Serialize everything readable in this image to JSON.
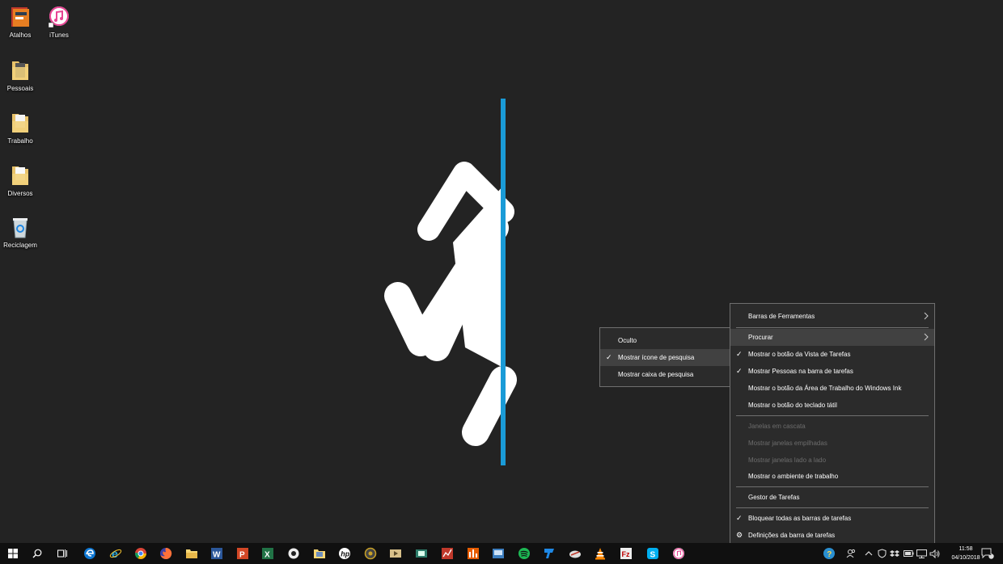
{
  "desktop": {
    "icons": [
      {
        "label": "Atalhos",
        "icon": "shortcuts-icon"
      },
      {
        "label": "iTunes",
        "icon": "itunes-icon"
      },
      {
        "label": "Pessoais",
        "icon": "folder-icon"
      },
      {
        "label": "Trabalho",
        "icon": "folder-icon"
      },
      {
        "label": "Diversos",
        "icon": "folder-icon"
      },
      {
        "label": "Reciclagem",
        "icon": "recycle-bin-icon"
      }
    ]
  },
  "submenu_search": {
    "items": [
      {
        "label": "Oculto",
        "checked": false
      },
      {
        "label": "Mostrar ícone de pesquisa",
        "checked": true
      },
      {
        "label": "Mostrar caixa de pesquisa",
        "checked": false
      }
    ]
  },
  "context_menu": {
    "items": [
      {
        "label": "Barras de Ferramentas",
        "submenu": true
      },
      {
        "label": "Procurar",
        "submenu": true
      },
      {
        "label": "Mostrar o botão da Vista de Tarefas",
        "checked": true
      },
      {
        "label": "Mostrar Pessoas na barra de tarefas",
        "checked": true
      },
      {
        "label": "Mostrar o botão da Área de Trabalho do Windows Ink"
      },
      {
        "label": "Mostrar o botão do teclado tátil"
      },
      {
        "label": "Janelas em cascata",
        "disabled": true
      },
      {
        "label": "Mostrar janelas empilhadas",
        "disabled": true
      },
      {
        "label": "Mostrar janelas lado a lado",
        "disabled": true
      },
      {
        "label": "Mostrar o ambiente de trabalho"
      },
      {
        "label": "Gestor de Tarefas"
      },
      {
        "label": "Bloquear todas as barras de tarefas",
        "checked": true
      },
      {
        "label": "Definições da barra de tarefas",
        "icon": "gear-icon"
      }
    ]
  },
  "taskbar": {
    "apps": [
      "start-icon",
      "search-icon",
      "task-view-icon",
      "edge-icon",
      "internet-explorer-icon",
      "chrome-icon",
      "firefox-icon",
      "file-explorer-icon",
      "word-icon",
      "powerpoint-icon",
      "excel-icon",
      "media-icon",
      "photo-folder-icon",
      "hp-icon",
      "camera-icon",
      "video-player-icon",
      "screen-capture-icon",
      "chart-app-icon",
      "audio-mixer-icon",
      "control-panel-icon",
      "spotify-icon",
      "publisher-icon",
      "cloud-app-icon",
      "vlc-icon",
      "filezilla-icon",
      "skype-icon",
      "itunes-icon"
    ],
    "tray": {
      "icons": [
        "help-icon",
        "people-icon",
        "chevron-up-icon",
        "shield-icon",
        "dropbox-icon",
        "battery-icon",
        "network-icon",
        "volume-icon"
      ],
      "time": "11:58",
      "date": "04/10/2018",
      "notification_count": "1"
    }
  },
  "colors": {
    "background": "#232323",
    "menu_bg": "#2b2b2b",
    "portal_blue": "#1a9bd7",
    "taskbar": "#101010"
  }
}
